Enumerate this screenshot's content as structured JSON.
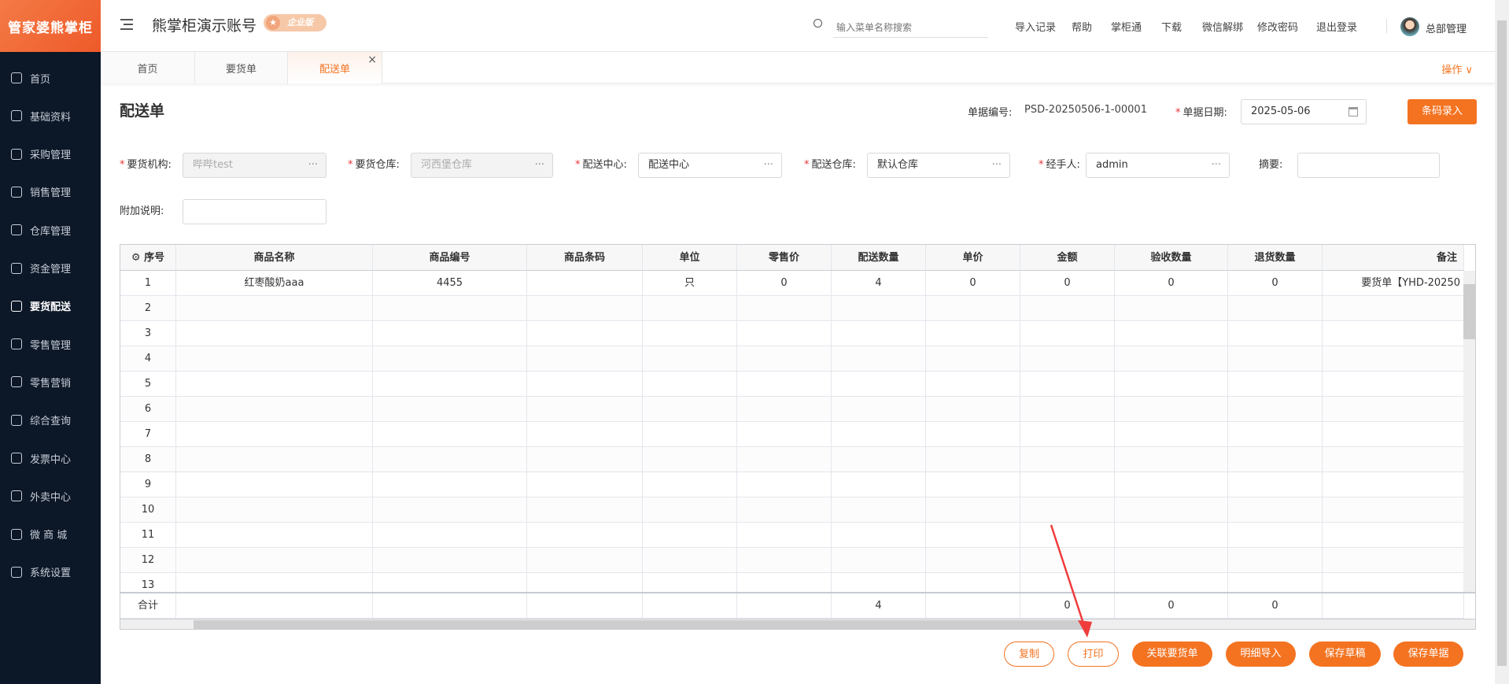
{
  "brand": {
    "logo_text": "管家婆熊掌柜",
    "account_name": "熊掌柜演示账号",
    "edition_badge": "企业版"
  },
  "search": {
    "placeholder": "输入菜单名称搜索"
  },
  "header_links": [
    "导入记录",
    "帮助",
    "掌柜通",
    "下载",
    "微信解绑",
    "修改密码",
    "退出登录"
  ],
  "user": {
    "name": "总部管理"
  },
  "sidebar": {
    "items": [
      {
        "label": "首页",
        "icon": "globe-icon"
      },
      {
        "label": "基础资料",
        "icon": "home-icon"
      },
      {
        "label": "采购管理",
        "icon": "cart-icon"
      },
      {
        "label": "销售管理",
        "icon": "sales-icon"
      },
      {
        "label": "仓库管理",
        "icon": "warehouse-icon"
      },
      {
        "label": "资金管理",
        "icon": "money-icon"
      },
      {
        "label": "要货配送",
        "icon": "list-icon",
        "active": true
      },
      {
        "label": "零售管理",
        "icon": "chart-icon"
      },
      {
        "label": "零售营销",
        "icon": "gift-icon"
      },
      {
        "label": "综合查询",
        "icon": "bar-chart-icon"
      },
      {
        "label": "发票中心",
        "icon": "invoice-icon"
      },
      {
        "label": "外卖中心",
        "icon": "delivery-icon"
      },
      {
        "label": "微 商 城",
        "icon": "shop-icon"
      },
      {
        "label": "系统设置",
        "icon": "gear-icon"
      }
    ]
  },
  "tabs": [
    {
      "label": "首页"
    },
    {
      "label": "要货单"
    },
    {
      "label": "配送单",
      "active": true,
      "close": "×"
    }
  ],
  "operations_label": "操作 ∨",
  "page": {
    "title": "配送单",
    "doc_no_label": "单据编号:",
    "doc_no": "PSD-20250506-1-00001",
    "date_label": "单据日期:",
    "date": "2025-05-06",
    "barcode_button": "条码录入"
  },
  "form": {
    "fields": [
      {
        "label": "要货机构:",
        "value": "哔哔test",
        "required": true,
        "disabled": true
      },
      {
        "label": "要货仓库:",
        "value": "河西堡仓库",
        "required": true,
        "disabled": true
      },
      {
        "label": "配送中心:",
        "value": "配送中心",
        "required": true
      },
      {
        "label": "配送仓库:",
        "value": "默认仓库",
        "required": true
      },
      {
        "label": "经手人:",
        "value": "admin",
        "required": true
      },
      {
        "label": "摘要:",
        "value": ""
      }
    ],
    "extra_label": "附加说明:",
    "extra_value": ""
  },
  "table": {
    "columns": [
      "序号",
      "商品名称",
      "商品编号",
      "商品条码",
      "单位",
      "零售价",
      "配送数量",
      "单价",
      "金额",
      "验收数量",
      "退货数量",
      "备注"
    ],
    "rows": [
      [
        "1",
        "红枣酸奶aaa",
        "4455",
        "",
        "只",
        "0",
        "4",
        "0",
        "0",
        "0",
        "0",
        "要货单【YHD-20250"
      ],
      [
        "2"
      ],
      [
        "3"
      ],
      [
        "4"
      ],
      [
        "5"
      ],
      [
        "6"
      ],
      [
        "7"
      ],
      [
        "8"
      ],
      [
        "9"
      ],
      [
        "10"
      ],
      [
        "11"
      ],
      [
        "12"
      ],
      [
        "13"
      ]
    ],
    "total": [
      "合计",
      "",
      "",
      "",
      "",
      "",
      "4",
      "",
      "0",
      "0",
      "0",
      ""
    ]
  },
  "actions": [
    "复制",
    "打印",
    "关联要货单",
    "明细导入",
    "保存草稿",
    "保存单据"
  ]
}
